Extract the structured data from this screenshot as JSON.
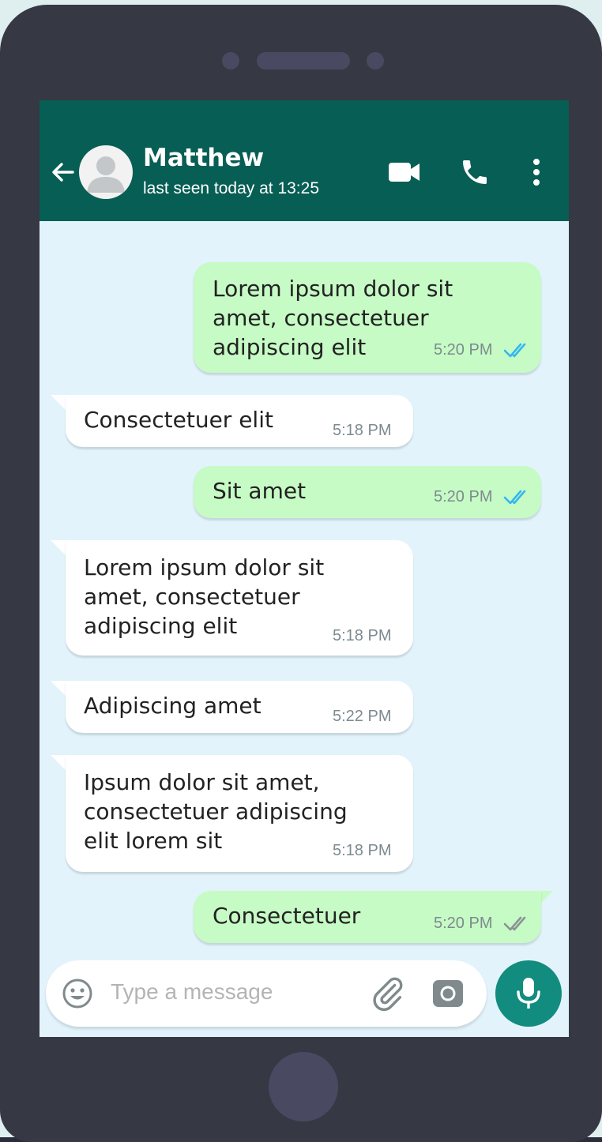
{
  "header": {
    "contact_name": "Matthew",
    "status": "last seen today at 13:25",
    "icons": [
      "back-arrow-icon",
      "avatar-icon",
      "video-call-icon",
      "phone-call-icon",
      "more-options-icon"
    ]
  },
  "messages": [
    {
      "direction": "outgoing",
      "text": "Lorem ipsum dolor sit\namet, consectetuer\nadipiscing elit",
      "time": "5:20 PM",
      "read_status": "read"
    },
    {
      "direction": "incoming",
      "text": "Consectetuer elit",
      "time": "5:18 PM"
    },
    {
      "direction": "outgoing",
      "text": "Sit amet",
      "time": "5:20 PM",
      "read_status": "read"
    },
    {
      "direction": "incoming",
      "text": "Lorem ipsum dolor sit\namet, consectetuer\nadipiscing elit",
      "time": "5:18 PM"
    },
    {
      "direction": "incoming",
      "text": "Adipiscing amet",
      "time": "5:22 PM"
    },
    {
      "direction": "incoming",
      "text": "Ipsum dolor sit amet,\nconsectetuer adipiscing\nelit lorem sit",
      "time": "5:18 PM"
    },
    {
      "direction": "outgoing",
      "text": "Consectetuer",
      "time": "5:20 PM",
      "read_status": "delivered"
    }
  ],
  "input": {
    "placeholder": "Type a message",
    "icons": [
      "emoji-icon",
      "attach-icon",
      "camera-icon",
      "microphone-icon"
    ]
  },
  "colors": {
    "header": "#075e54",
    "outgoing_bubble": "#c6fbc5",
    "incoming_bubble": "#ffffff",
    "chat_background": "#e2f3fb",
    "read_ticks": "#34b7f1",
    "mic_button": "#128c7e"
  }
}
